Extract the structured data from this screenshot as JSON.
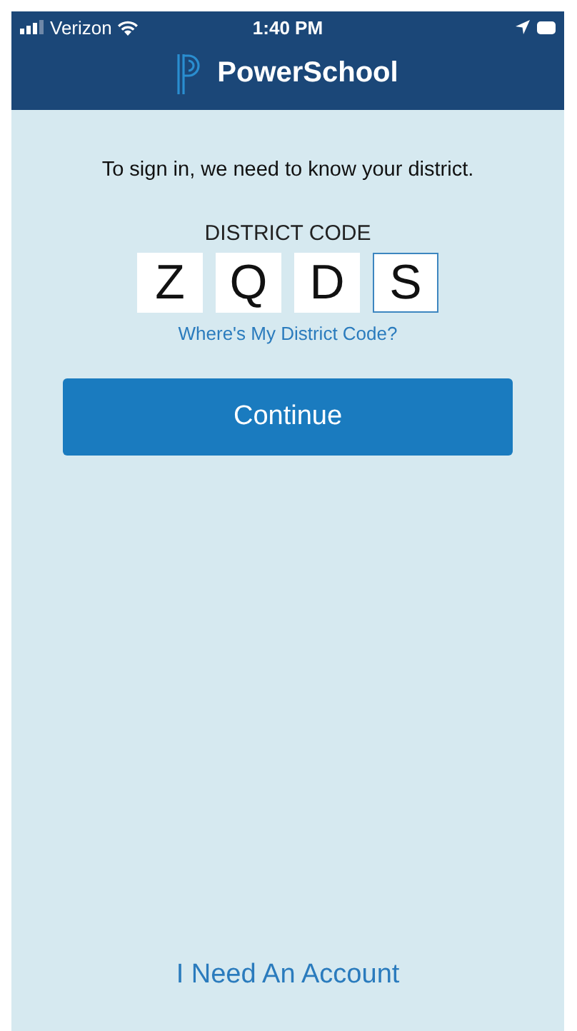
{
  "status_bar": {
    "carrier": "Verizon",
    "time": "1:40 PM"
  },
  "header": {
    "title": "PowerSchool"
  },
  "prompt": "To sign in, we need to know your district.",
  "district_code": {
    "label": "DISTRICT CODE",
    "characters": [
      {
        "value": "Z",
        "selected": false
      },
      {
        "value": "Q",
        "selected": false
      },
      {
        "value": "D",
        "selected": false
      },
      {
        "value": "S",
        "selected": true
      }
    ],
    "help_link": "Where's My District Code?"
  },
  "continue_button": "Continue",
  "account_link": "I Need An Account"
}
